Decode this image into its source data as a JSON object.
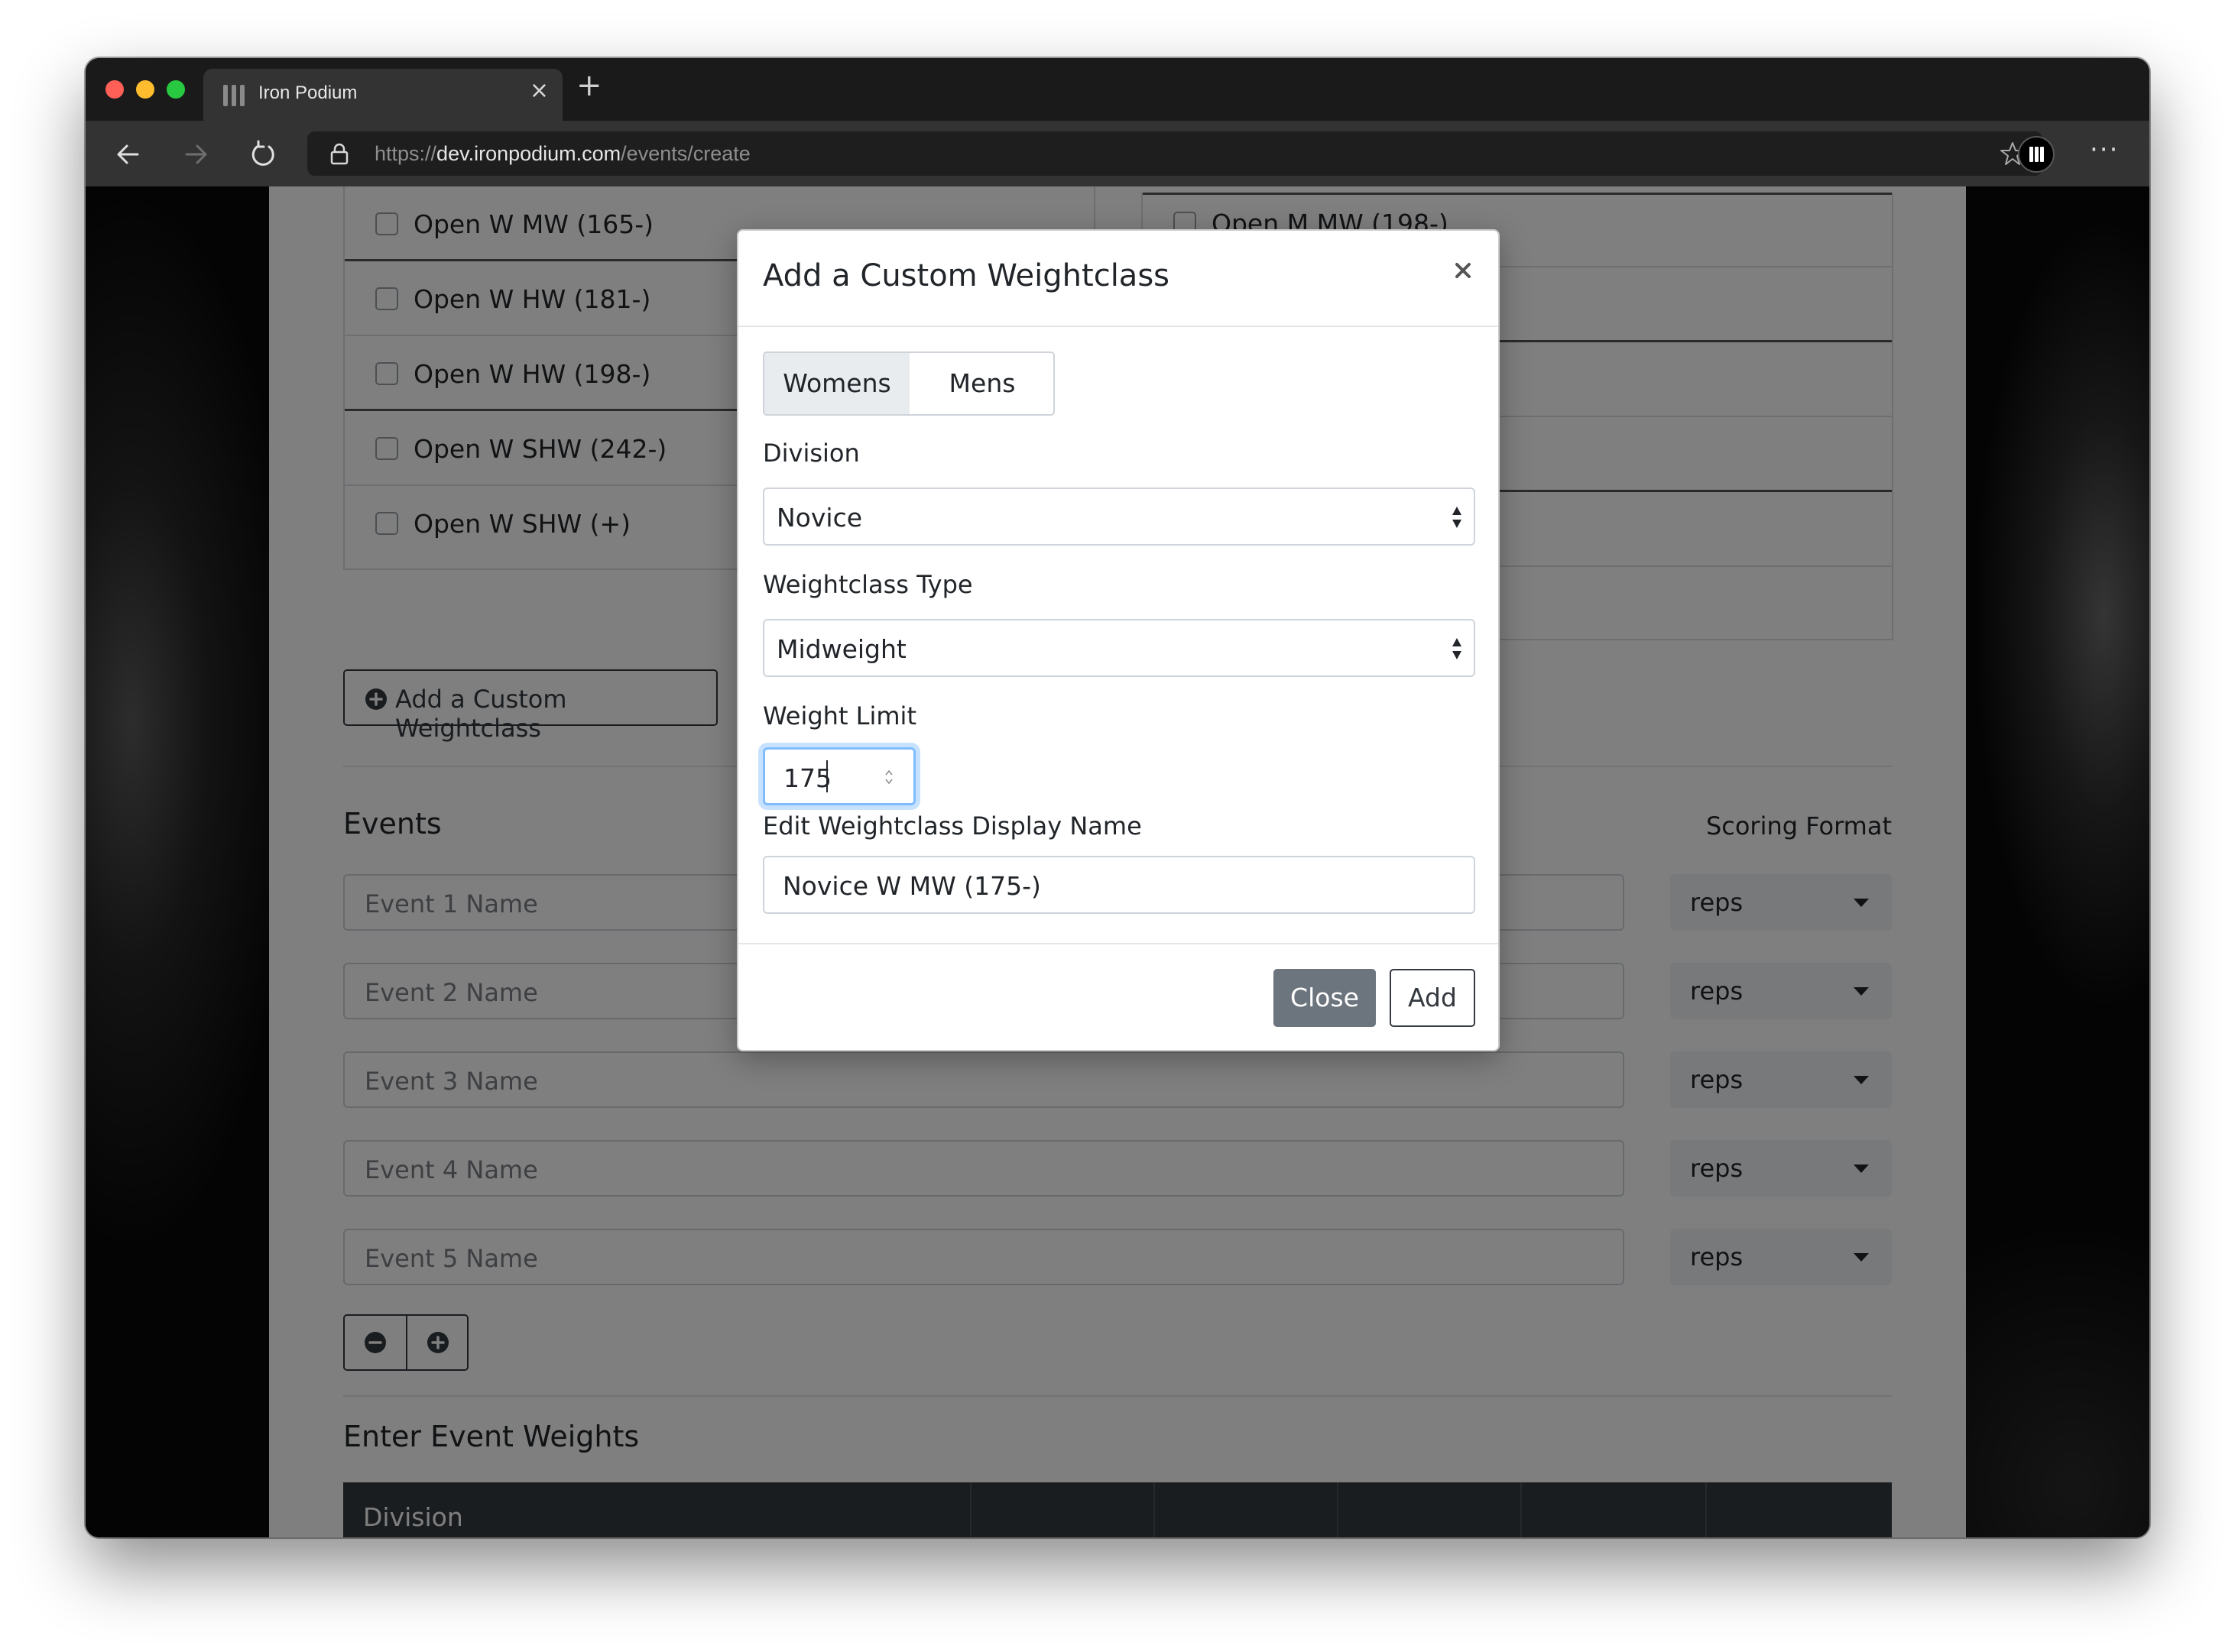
{
  "browser": {
    "tab_title": "Iron Podium",
    "url_scheme": "https://",
    "url_host": "dev.ironpodium.com",
    "url_path": "/events/create"
  },
  "page": {
    "weightclasses_left": [
      "Open W MW (165-)",
      "Open W HW (181-)",
      "Open W HW (198-)",
      "Open W SHW (242-)",
      "Open W SHW (+)"
    ],
    "weightclasses_right_partial": "Open M MW (198-)",
    "add_custom_button": "Add a Custom Weightclass",
    "events_title": "Events",
    "scoring_format_label": "Scoring Format",
    "events": [
      {
        "placeholder": "Event 1 Name",
        "scoring": "reps"
      },
      {
        "placeholder": "Event 2 Name",
        "scoring": "reps"
      },
      {
        "placeholder": "Event 3 Name",
        "scoring": "reps"
      },
      {
        "placeholder": "Event 4 Name",
        "scoring": "reps"
      },
      {
        "placeholder": "Event 5 Name",
        "scoring": "reps"
      }
    ],
    "event_weights_title": "Enter Event Weights",
    "table_header_first": "Division"
  },
  "modal": {
    "title": "Add a Custom Weightclass",
    "gender_options": [
      "Womens",
      "Mens"
    ],
    "gender_selected": "Womens",
    "division_label": "Division",
    "division_value": "Novice",
    "type_label": "Weightclass Type",
    "type_value": "Midweight",
    "weight_limit_label": "Weight Limit",
    "weight_limit_value": "175",
    "display_name_label": "Edit Weightclass Display Name",
    "display_name_value": "Novice W MW (175-)",
    "close_button": "Close",
    "add_button": "Add"
  }
}
